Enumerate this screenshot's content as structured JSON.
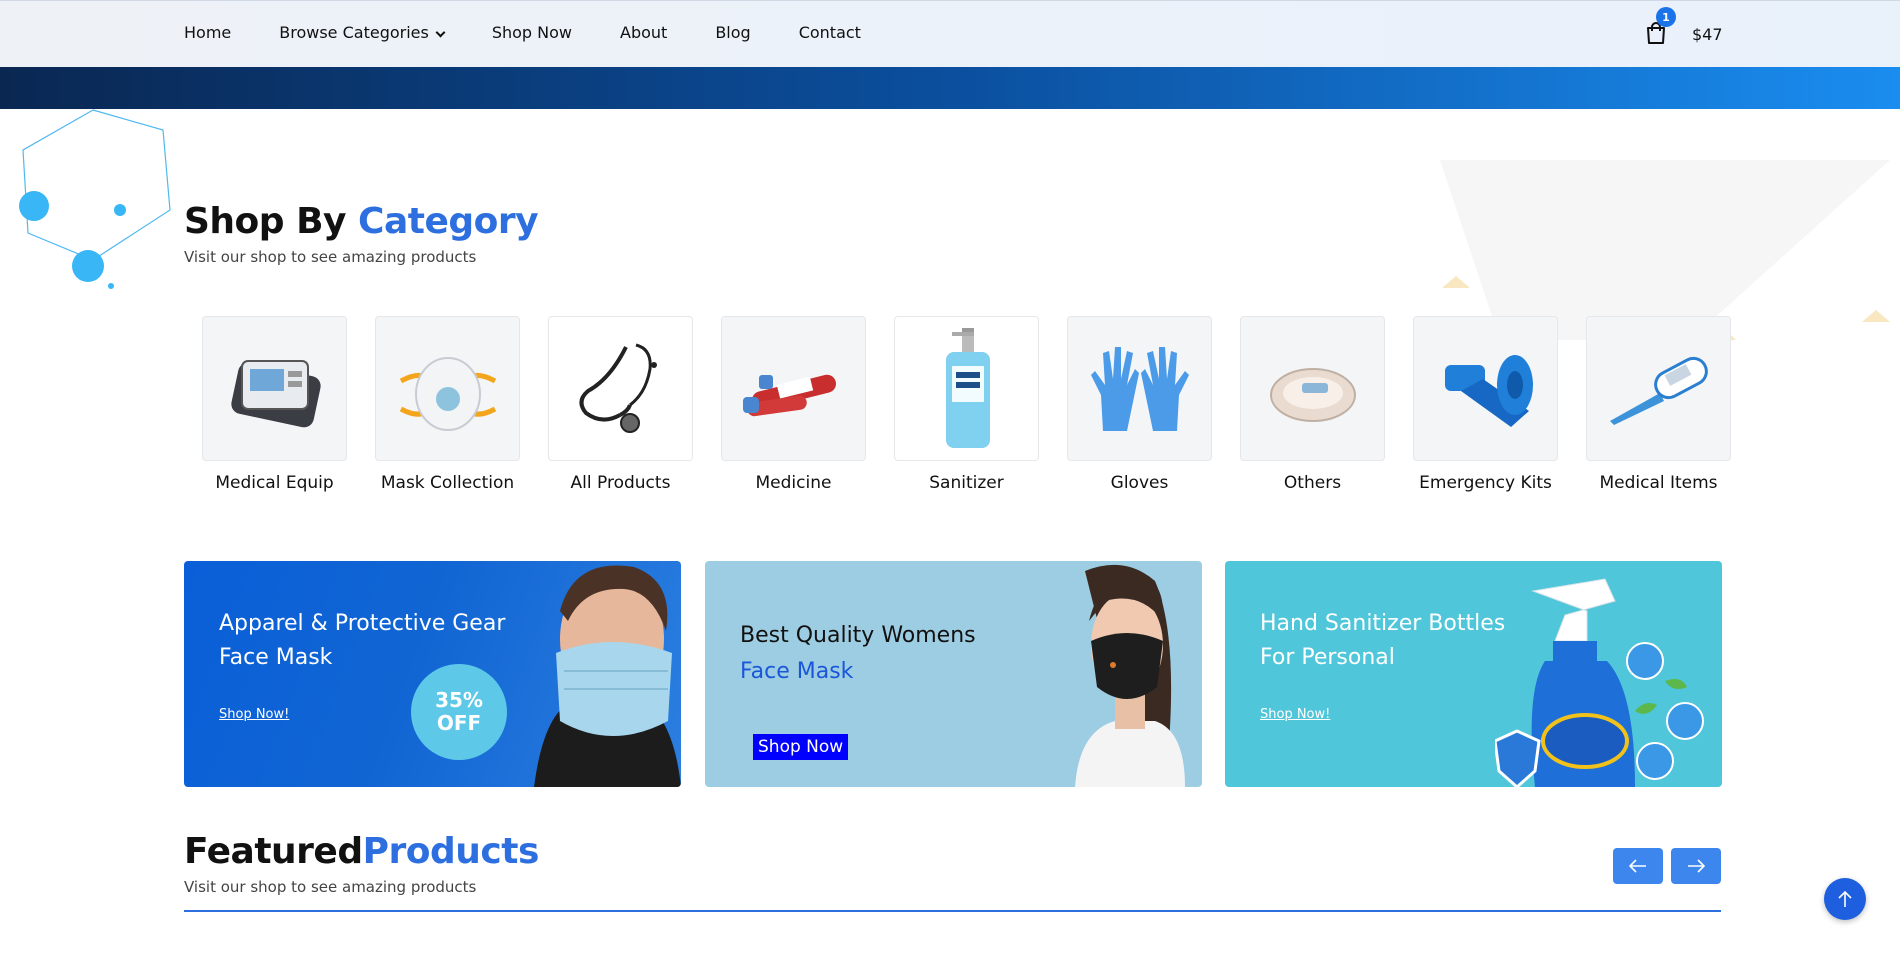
{
  "nav": {
    "items": [
      {
        "label": "Home"
      },
      {
        "label": "Browse Categories"
      },
      {
        "label": "Shop Now"
      },
      {
        "label": "About"
      },
      {
        "label": "Blog"
      },
      {
        "label": "Contact"
      }
    ],
    "cart_count": "1",
    "cart_total": "$47"
  },
  "category_section": {
    "title_main": "Shop By ",
    "title_accent": "Category",
    "subtitle": "Visit our shop to see amazing products",
    "categories": [
      {
        "label": "Medical Equip",
        "icon": "medical-monitor-icon"
      },
      {
        "label": "Mask Collection",
        "icon": "mask-icon"
      },
      {
        "label": "All Products",
        "icon": "stethoscope-icon"
      },
      {
        "label": "Medicine",
        "icon": "test-tube-icon"
      },
      {
        "label": "Sanitizer",
        "icon": "gel-bottle-icon"
      },
      {
        "label": "Gloves",
        "icon": "gloves-icon"
      },
      {
        "label": "Others",
        "icon": "tray-icon"
      },
      {
        "label": "Emergency Kits",
        "icon": "bandage-icon"
      },
      {
        "label": "Medical Items",
        "icon": "thermometer-icon"
      }
    ]
  },
  "banners": [
    {
      "line1": "Apparel & Protective Gear",
      "line2": "Face Mask",
      "badge_line1": "35%",
      "badge_line2": "OFF",
      "link": "Shop Now!"
    },
    {
      "line1": "Best Quality Womens",
      "line2": "Face Mask",
      "button": "Shop Now"
    },
    {
      "line1": "Hand Sanitizer Bottles",
      "line2": "For Personal",
      "link": "Shop Now!"
    }
  ],
  "featured": {
    "title_main": "Featured",
    "title_accent": "Products",
    "subtitle": "Visit our shop to see amazing products"
  },
  "colors": {
    "accent": "#2e6fe0",
    "banner_blue": "#0a5fd8",
    "banner_light": "#9dcde2",
    "banner_teal": "#4fc6d9",
    "shop_button": "#0000ff"
  }
}
